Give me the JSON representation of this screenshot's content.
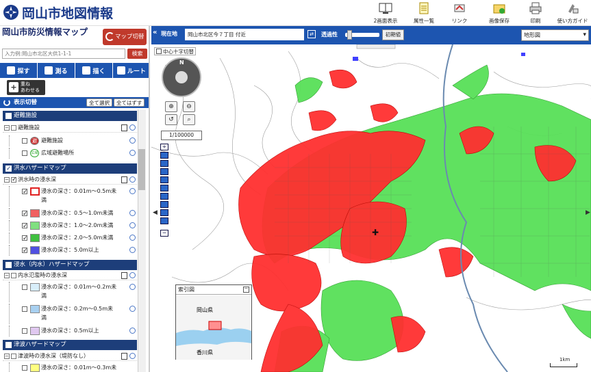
{
  "header": {
    "app_title": "岡山市地図情報",
    "toolbar": [
      {
        "id": "dual",
        "label": "2画面表示",
        "icon": "dual-screen-icon"
      },
      {
        "id": "attr",
        "label": "属性一覧",
        "icon": "attribute-list-icon"
      },
      {
        "id": "link",
        "label": "リンク",
        "icon": "link-icon"
      },
      {
        "id": "save",
        "label": "画像保存",
        "icon": "image-save-icon"
      },
      {
        "id": "print",
        "label": "印刷",
        "icon": "print-icon"
      },
      {
        "id": "help",
        "label": "使い方ガイド",
        "icon": "help-guide-icon"
      }
    ]
  },
  "panel": {
    "title": "岡山市防災情報マップ",
    "switch_label": "マップ切替",
    "search_placeholder": "入力例:岡山市北区大供1-1-1",
    "search_button": "検索",
    "tools": [
      "探す",
      "測る",
      "描く",
      "ルート"
    ],
    "overlay_label_1": "重ね",
    "overlay_label_2": "あわせる",
    "display_toggle": "表示切替",
    "select_all": "全て選択",
    "clear_all": "全てはずす"
  },
  "layers": {
    "g1": "避難施設",
    "g1_sub": "避難施設",
    "g1_item1": "避難施設",
    "g1_item2": "広域避難場所",
    "g1_badge1": "避",
    "g1_badge2": "広域",
    "g2": "洪水ハザードマップ",
    "g2_sub": "洪水時の浸水深",
    "g2_items": [
      {
        "label": "浸水の深さ：0.01m〜0.5m未",
        "label2": "満",
        "color": "#ffffff",
        "border": "#e02020"
      },
      {
        "label": "浸水の深さ：0.5〜1.0m未満",
        "color": "#f06060",
        "border": "#c00"
      },
      {
        "label": "浸水の深さ：1.0〜2.0m未満",
        "color": "#80e080",
        "border": "#4a4"
      },
      {
        "label": "浸水の深さ：2.0〜5.0m未満",
        "color": "#40c040",
        "border": "#282"
      },
      {
        "label": "浸水の深さ：5.0m以上",
        "color": "#5050e0",
        "border": "#228"
      }
    ],
    "g3": "浸水（内水）ハザードマップ",
    "g3_sub": "内水氾濫時の浸水深",
    "g3_items": [
      {
        "label": "浸水の深さ：0.01m〜0.2m未",
        "label2": "満",
        "color": "#d8eefa"
      },
      {
        "label": "浸水の深さ：0.2m〜0.5m未",
        "label2": "満",
        "color": "#a8d0f0"
      },
      {
        "label": "浸水の深さ：0.5m以上",
        "color": "#e0c8f0"
      }
    ],
    "g4": "津波ハザードマップ",
    "g4_sub": "津波時の浸水深（堤防なし）",
    "g4_item1": "浸水の深さ：0.01m〜0.3m未"
  },
  "map": {
    "current_label": "現在地",
    "current_position": "岡山市北区今７丁目 付近",
    "opacity_label": "透過性",
    "opacity_reset": "初期値",
    "basemap": "地形図",
    "crosshair": "中心十字切替",
    "scale": "1/100000",
    "compass_n": "N",
    "index_title": "索引図",
    "index_pref_1": "岡山県",
    "index_pref_2": "香川県",
    "scale_bar": "1km"
  },
  "colors": {
    "accent": "#1d55b0",
    "danger": "#c0392b",
    "flood_red": "#ff2020",
    "flood_green": "#50e050"
  }
}
